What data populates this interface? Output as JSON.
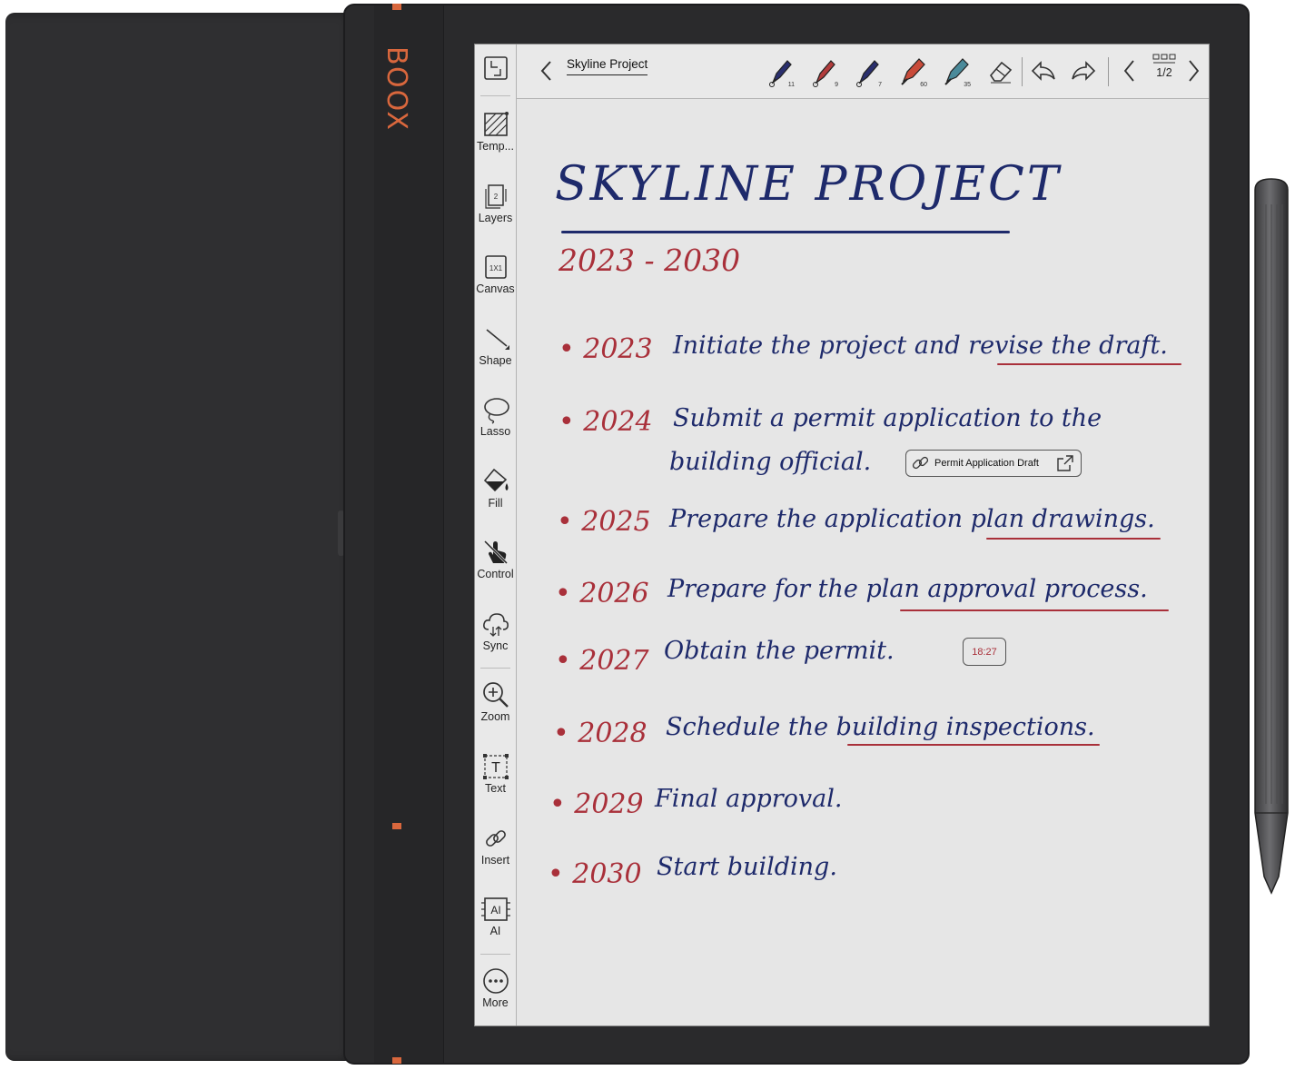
{
  "brand": {
    "name": "BOOX"
  },
  "toolbar": {
    "note_title": "Skyline Project",
    "pens": [
      {
        "name": "pen-1",
        "size": "11",
        "color": "#2a2f6e"
      },
      {
        "name": "pen-2",
        "size": "9",
        "color": "#b23c3c"
      },
      {
        "name": "pen-3",
        "size": "7",
        "color": "#2a2f6e"
      },
      {
        "name": "marker",
        "size": "60",
        "color": "#c94b3a"
      },
      {
        "name": "highlighter",
        "size": "35",
        "color": "#4a8a9a"
      }
    ],
    "page_indicator": "1/2"
  },
  "sidebar": {
    "items": [
      {
        "label": "Temp..."
      },
      {
        "label": "Layers"
      },
      {
        "label": "Canvas"
      },
      {
        "label": "Shape"
      },
      {
        "label": "Lasso"
      },
      {
        "label": "Fill"
      },
      {
        "label": "Control"
      },
      {
        "label": "Sync"
      },
      {
        "label": "Zoom"
      },
      {
        "label": "Text"
      },
      {
        "label": "Insert"
      },
      {
        "label": "AI"
      },
      {
        "label": "More"
      }
    ],
    "layers_count": "2",
    "canvas_ratio": "1X1",
    "text_glyph": "T",
    "ai_glyph": "AI"
  },
  "note": {
    "title": "SKYLINE PROJECT",
    "subtitle": "2023 - 2030",
    "entries": [
      {
        "year": "2023",
        "text": "Initiate the project and revise the draft."
      },
      {
        "year": "2024",
        "text": "Submit a permit application to the",
        "text2": "building official."
      },
      {
        "year": "2025",
        "text": "Prepare the application plan drawings."
      },
      {
        "year": "2026",
        "text": "Prepare for the plan approval process."
      },
      {
        "year": "2027",
        "text": "Obtain the permit."
      },
      {
        "year": "2028",
        "text": "Schedule the building inspections."
      },
      {
        "year": "2029",
        "text": "Final approval."
      },
      {
        "year": "2030",
        "text": "Start building."
      }
    ],
    "link_chip": "Permit Application Draft",
    "time_stamp": "18:27"
  },
  "colors": {
    "ink_blue": "#1e2a6b",
    "ink_red": "#a9303a",
    "accent_orange": "#d9673d"
  }
}
